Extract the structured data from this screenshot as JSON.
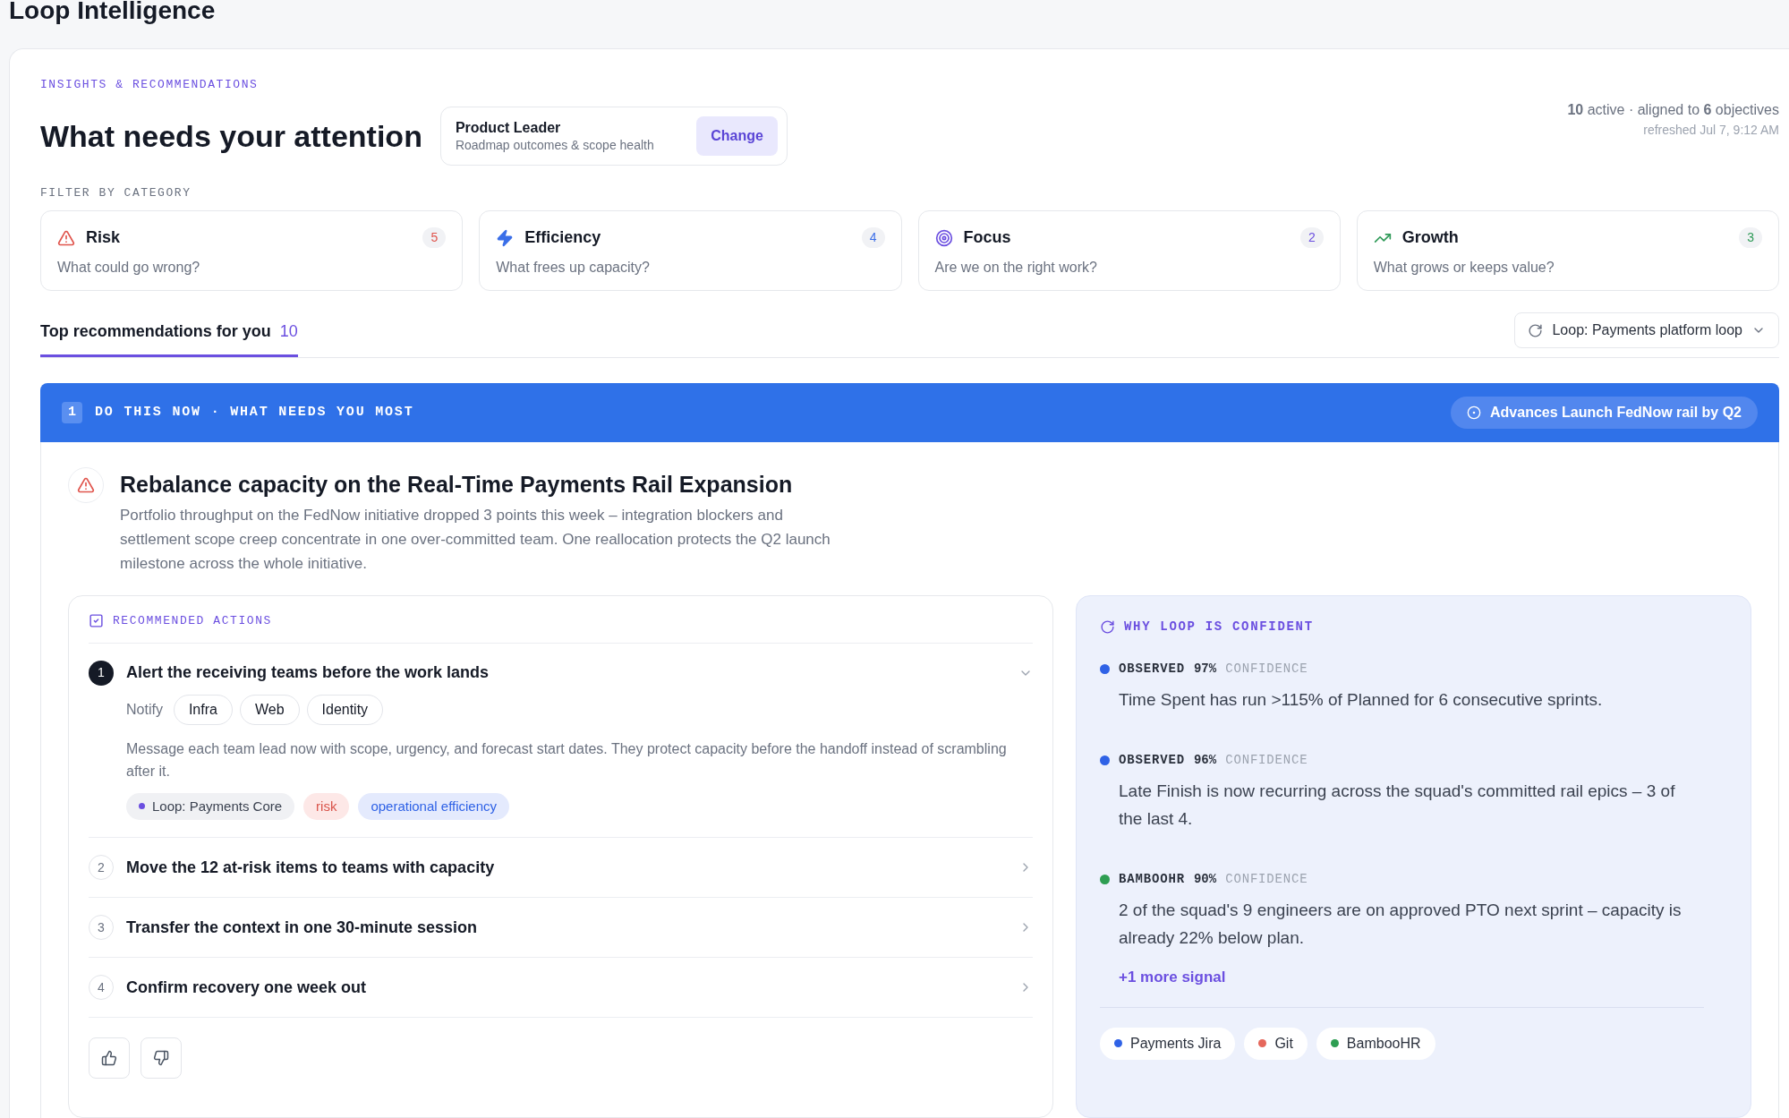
{
  "app_title": "Loop Intelligence",
  "eyebrow": "INSIGHTS & RECOMMENDATIONS",
  "heading": "What needs your attention",
  "persona": {
    "name": "Product Leader",
    "description": "Roadmap outcomes & scope health",
    "button": "Change"
  },
  "summary": {
    "line": "**10** active · aligned to **6** objectives",
    "refreshed": "refreshed Jul 7, 9:12 AM"
  },
  "filter_label": "FILTER BY CATEGORY",
  "categories": [
    {
      "kind": "risk",
      "title": "Risk",
      "question": "What could go wrong?",
      "count": "5",
      "color": "#e0544c"
    },
    {
      "kind": "efficiency",
      "title": "Efficiency",
      "question": "What frees up capacity?",
      "count": "4",
      "color": "#3b6fe8"
    },
    {
      "kind": "focus",
      "title": "Focus",
      "question": "Are we on the right work?",
      "count": "2",
      "color": "#6b4fe0"
    },
    {
      "kind": "growth",
      "title": "Growth",
      "question": "What grows or keeps value?",
      "count": "3",
      "color": "#2f9a58"
    }
  ],
  "tabs": [
    {
      "label": "Top recommendations for you",
      "count": "10",
      "selected": true
    }
  ],
  "loop_select": {
    "label": "Loop: Payments platform loop"
  },
  "recommendation": {
    "rank": "1",
    "banner": "DO THIS NOW · WHAT NEEDS YOU MOST",
    "objective": "Advances Launch FedNow rail by Q2",
    "title": "Rebalance capacity on the Real-Time Payments Rail Expansion",
    "description": "Portfolio throughput on the FedNow initiative dropped 3 points this week – integration blockers and settlement scope creep concentrate in one over-committed team. One reallocation protects the Q2 launch milestone across the whole initiative.",
    "actions_heading": "RECOMMENDED ACTIONS",
    "actions": [
      {
        "number": "1",
        "title": "Alert the receiving teams before the work lands",
        "expanded": true,
        "notify_label": "Notify",
        "teams": [
          "Infra",
          "Web",
          "Identity"
        ],
        "detail": "Message each team lead now with scope, urgency, and forecast start dates. They protect capacity before the handoff instead of scrambling after it.",
        "tags": [
          {
            "kind": "loop",
            "label": "Loop: Payments Core"
          },
          {
            "kind": "risk",
            "label": "risk"
          },
          {
            "kind": "efficiency",
            "label": "operational efficiency"
          }
        ]
      },
      {
        "number": "2",
        "title": "Move the 12 at-risk items to teams with capacity",
        "expanded": false
      },
      {
        "number": "3",
        "title": "Transfer the context in one 30-minute session",
        "expanded": false
      },
      {
        "number": "4",
        "title": "Confirm recovery one week out",
        "expanded": false
      }
    ],
    "confidence": {
      "heading": "WHY LOOP IS CONFIDENT",
      "signals": [
        {
          "source": "OBSERVED",
          "percent": "97%",
          "suffix": "CONFIDENCE",
          "text": "Time Spent has run >115% of Planned for 6 consecutive sprints.",
          "color": "#2f62e6"
        },
        {
          "source": "OBSERVED",
          "percent": "96%",
          "suffix": "CONFIDENCE",
          "text": "Late Finish is now recurring across the squad's committed rail epics – 3 of the last 4.",
          "color": "#2f62e6"
        },
        {
          "source": "BAMBOOHR",
          "percent": "90%",
          "suffix": "CONFIDENCE",
          "text": "2 of the squad's 9 engineers are on approved PTO next sprint – capacity is already 22% below plan.",
          "color": "#2e9e52"
        }
      ],
      "more_link": "+1 more signal",
      "sources": [
        {
          "label": "Payments Jira",
          "color": "#2f62e6"
        },
        {
          "label": "Git",
          "color": "#e5675b"
        },
        {
          "label": "BambooHR",
          "color": "#2e9e52"
        }
      ]
    }
  }
}
